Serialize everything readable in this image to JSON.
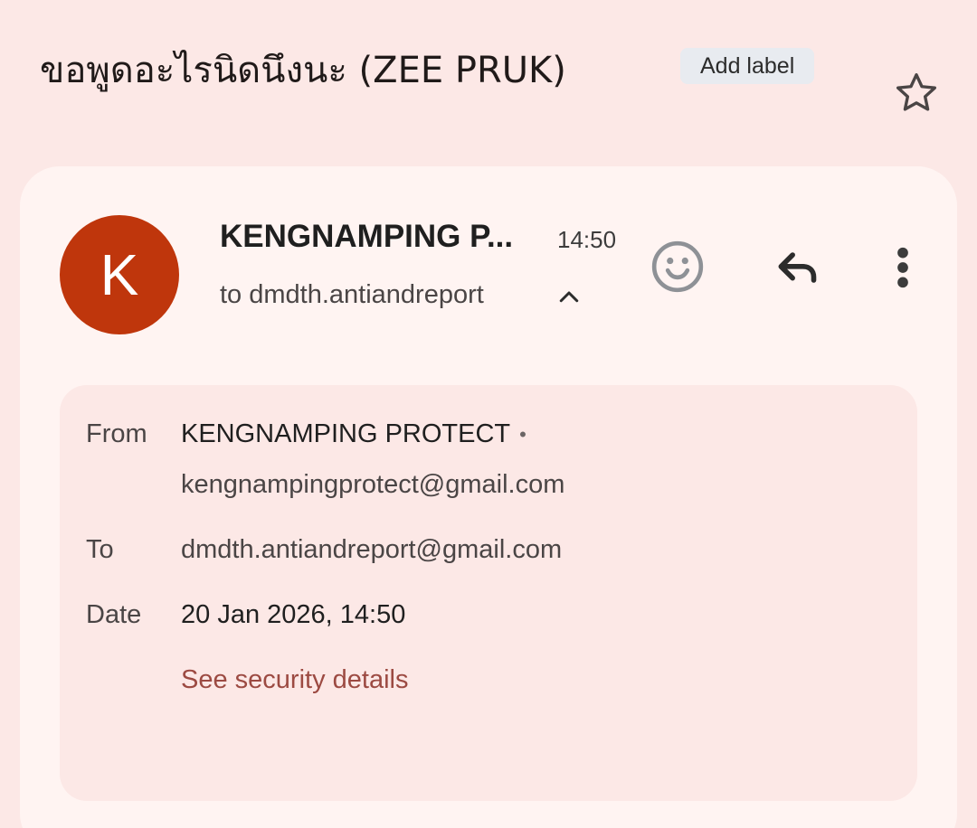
{
  "email": {
    "subject": "ขอพูดอะไรนิดนึงนะ (ZEE PRUK)",
    "add_label": "Add label",
    "star_icon": "star-outline-icon",
    "sender": {
      "initial": "K",
      "avatar_color": "#bf360c",
      "display_name_truncated": "KENGNAMPING P...",
      "time": "14:50",
      "to_line": "to dmdth.antiandreport"
    },
    "actions": {
      "emoji_icon": "smile-face-icon",
      "reply_icon": "reply-arrow-icon",
      "more_icon": "more-vert-icon"
    },
    "details": {
      "from_label": "From",
      "from_name": "KENGNAMPING PROTECT",
      "from_dot": "•",
      "from_email": "kengnampingprotect@gmail.com",
      "to_label": "To",
      "to_email": "dmdth.antiandreport@gmail.com",
      "date_label": "Date",
      "date_value": "20 Jan 2026, 14:50",
      "security_link": "See security details"
    }
  },
  "colors": {
    "page_background": "#fce8e6",
    "card_background": "#fff4f2",
    "link": "#9c4a42"
  }
}
